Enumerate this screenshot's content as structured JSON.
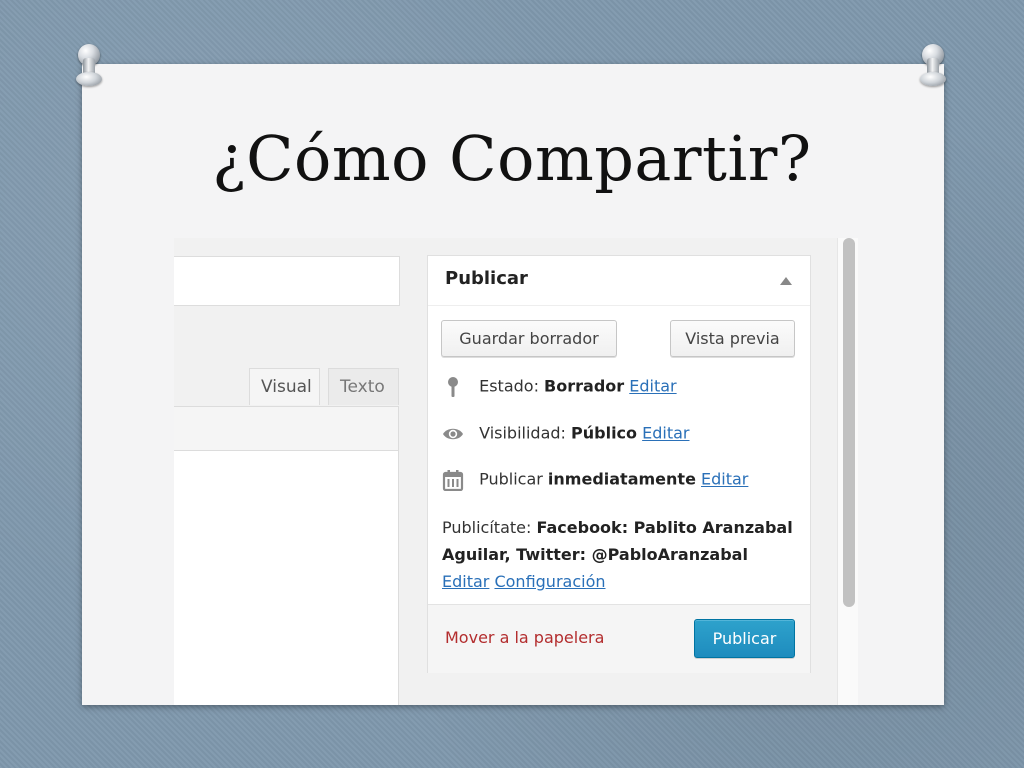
{
  "slide": {
    "title": "¿Cómo Compartir?"
  },
  "editor": {
    "tabs": [
      {
        "label": "Visual"
      },
      {
        "label": "Texto"
      }
    ]
  },
  "publish_box": {
    "title": "Publicar",
    "buttons": {
      "save_draft": "Guardar borrador",
      "preview": "Vista previa",
      "publish": "Publicar"
    },
    "status": {
      "label": "Estado:",
      "value": "Borrador",
      "edit": "Editar"
    },
    "visibility": {
      "label": "Visibilidad:",
      "value": "Público",
      "edit": "Editar"
    },
    "schedule": {
      "label": "Publicar",
      "value": "inmediatamente",
      "edit": "Editar"
    },
    "share": {
      "label": "Publicítate:",
      "line1": "Facebook: Pablito Aranzabal",
      "line2": "Aguilar, Twitter: @PabloAranzabal",
      "edit": "Editar",
      "settings": "Configuración"
    },
    "trash": "Mover a la papelera"
  },
  "icons": {
    "status": "pin-icon",
    "visibility": "eye-icon",
    "schedule": "calendar-icon",
    "collapse": "triangle-up-icon"
  },
  "colors": {
    "link": "#2a70b8",
    "trash": "#b32d2e",
    "publish_button": "#1e8cbe"
  }
}
